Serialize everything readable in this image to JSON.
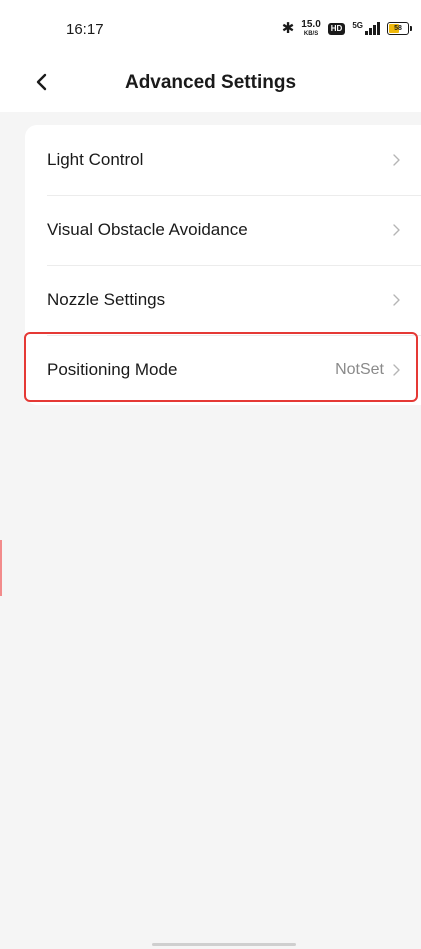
{
  "status_bar": {
    "time": "16:17",
    "bluetooth_icon": "bluetooth-icon",
    "network_speed": {
      "value": "15.0",
      "unit": "KB/S"
    },
    "hd_badge": "HD",
    "signal_label": "5G",
    "battery_level": "58",
    "battery_fraction": 0.58
  },
  "header": {
    "back_icon": "chevron-left-icon",
    "title": "Advanced Settings"
  },
  "settings": {
    "items": [
      {
        "label": "Light Control",
        "value": ""
      },
      {
        "label": "Visual Obstacle Avoidance",
        "value": ""
      },
      {
        "label": "Nozzle Settings",
        "value": ""
      },
      {
        "label": "Positioning Mode",
        "value": "NotSet"
      }
    ],
    "chevron_icon": "chevron-right-icon"
  },
  "colors": {
    "background": "#f5f5f5",
    "card": "#ffffff",
    "highlight": "#e53935",
    "secondary_text": "#8a8a8a"
  }
}
